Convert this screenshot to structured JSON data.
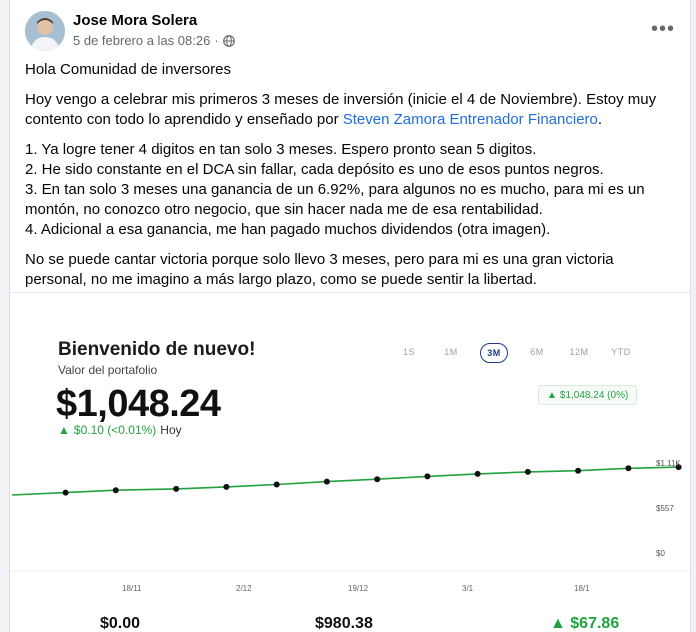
{
  "post": {
    "author": "Jose Mora Solera",
    "date": "5 de febrero a las 08:26",
    "more_icon": "more-horizontal-icon",
    "paragraph1": "Hola Comunidad de inversores",
    "paragraph2_text": "Hoy vengo a celebrar mis primeros 3 meses de inversión (inicie el 4 de Noviembre).  Estoy muy contento con todo lo aprendido y enseñado por ",
    "paragraph2_link": "Steven Zamora Entrenador Financiero",
    "paragraph2_end": ".",
    "list": [
      "1. Ya logre tener 4 digitos en tan solo 3 meses.  Espero pronto sean 5 digitos.",
      "2. He sido constante en el DCA sin fallar, cada depósito es uno de esos puntos negros.",
      "3. En tan solo 3 meses una ganancia de un 6.92%, para algunos no es mucho, para mi es un montón, no conozco otro negocio, que sin hacer nada me de esa rentabilidad.",
      "4. Adicional a esa ganancia, me han pagado muchos dividendos (otra imagen)."
    ],
    "paragraph_final": "No se puede cantar victoria porque solo llevo 3 meses, pero para mi es una gran victoria personal, no me imagino a más largo plazo, como se puede sentir la libertad."
  },
  "portfolio": {
    "welcome": "Bienvenido de nuevo!",
    "label": "Valor del portafolio",
    "value": "$1,048.24",
    "change_amount": "$0.10 (<0.01%)",
    "change_period": "Hoy",
    "ranges": [
      "1S",
      "1M",
      "3M",
      "6M",
      "12M",
      "YTD"
    ],
    "active_range": "3M",
    "pill": "$1,048.24 (0%)",
    "stats": [
      "$0.00",
      "$980.38",
      "$67.86"
    ],
    "colors": {
      "line": "#21a33f",
      "positive": "#21a33f",
      "active_range": "#1d3b8b"
    }
  },
  "chart_data": {
    "type": "line",
    "x_ticks": [
      "18/11",
      "2/12",
      "19/12",
      "3/1",
      "18/1"
    ],
    "y_ticks": [
      "$1.11K",
      "$557",
      "$0"
    ],
    "ylim": [
      0,
      1110
    ],
    "x": [
      0,
      0.08,
      0.155,
      0.245,
      0.32,
      0.395,
      0.47,
      0.545,
      0.62,
      0.695,
      0.77,
      0.845,
      0.92,
      0.995
    ],
    "y": [
      715,
      745,
      775,
      790,
      815,
      845,
      880,
      910,
      945,
      975,
      1000,
      1015,
      1045,
      1060
    ],
    "deposit_points": [
      0.08,
      0.155,
      0.245,
      0.32,
      0.395,
      0.47,
      0.545,
      0.62,
      0.695,
      0.77,
      0.845,
      0.92,
      0.995
    ],
    "grid": false
  }
}
